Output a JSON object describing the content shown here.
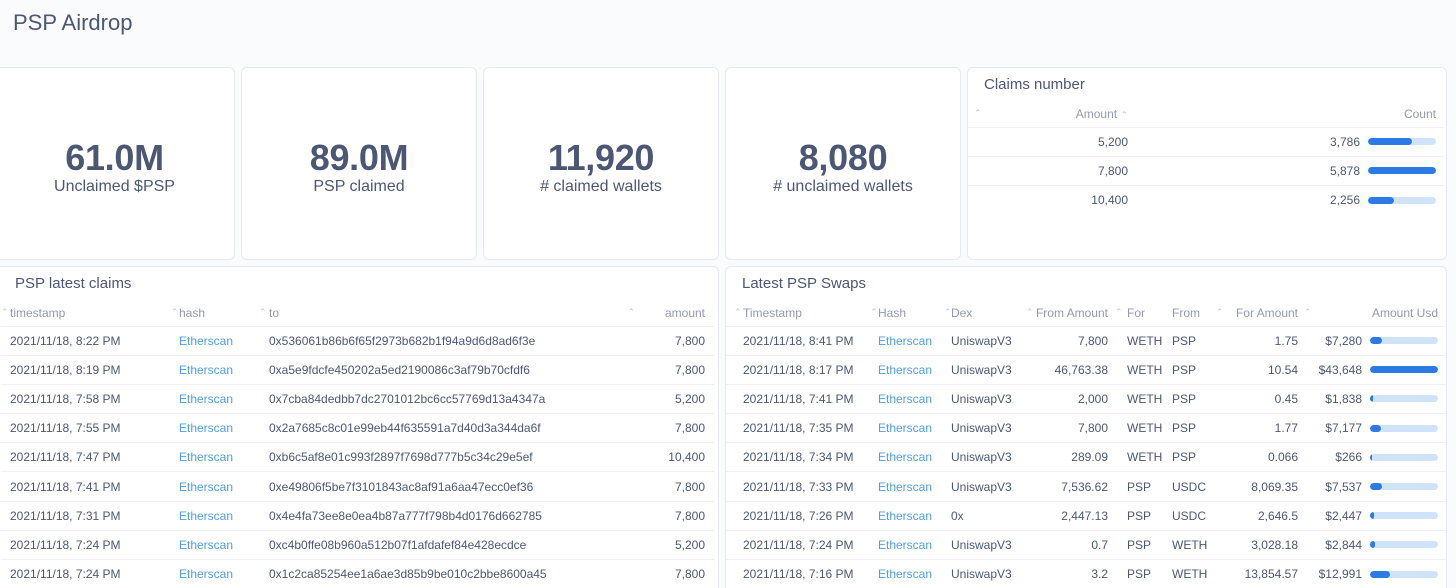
{
  "page": {
    "title": "PSP Airdrop"
  },
  "scalars": [
    {
      "value": "61.0M",
      "label": "Unclaimed $PSP"
    },
    {
      "value": "89.0M",
      "label": "PSP claimed"
    },
    {
      "value": "11,920",
      "label": "# claimed wallets"
    },
    {
      "value": "8,080",
      "label": "# unclaimed wallets"
    }
  ],
  "claims_number": {
    "title": "Claims number",
    "columns": [
      "Amount",
      "Count"
    ],
    "rows": [
      {
        "amount": "5,200",
        "count": "3,786",
        "fraction": 0.644
      },
      {
        "amount": "7,800",
        "count": "5,878",
        "fraction": 1.0
      },
      {
        "amount": "10,400",
        "count": "2,256",
        "fraction": 0.384
      }
    ]
  },
  "latest_claims": {
    "title": "PSP latest claims",
    "columns": [
      "timestamp",
      "hash",
      "to",
      "amount"
    ],
    "rows": [
      {
        "timestamp": "2021/11/18, 8:22 PM",
        "hash": "Etherscan",
        "to": "0x536061b86b6f65f2973b682b1f94a9d6d8ad6f3e",
        "amount": "7,800"
      },
      {
        "timestamp": "2021/11/18, 8:19 PM",
        "hash": "Etherscan",
        "to": "0xa5e9fdcfe450202a5ed2190086c3af79b70cfdf6",
        "amount": "7,800"
      },
      {
        "timestamp": "2021/11/18, 7:58 PM",
        "hash": "Etherscan",
        "to": "0x7cba84dedbb7dc2701012bc6cc57769d13a4347a",
        "amount": "5,200"
      },
      {
        "timestamp": "2021/11/18, 7:55 PM",
        "hash": "Etherscan",
        "to": "0x2a7685c8c01e99eb44f635591a7d40d3a344da6f",
        "amount": "7,800"
      },
      {
        "timestamp": "2021/11/18, 7:47 PM",
        "hash": "Etherscan",
        "to": "0xb6c5af8e01c993f2897f7698d777b5c34c29e5ef",
        "amount": "10,400"
      },
      {
        "timestamp": "2021/11/18, 7:41 PM",
        "hash": "Etherscan",
        "to": "0xe49806f5be7f3101843ac8af91a6aa47ecc0ef36",
        "amount": "7,800"
      },
      {
        "timestamp": "2021/11/18, 7:31 PM",
        "hash": "Etherscan",
        "to": "0x4e4fa73ee8e0ea4b87a777f798b4d0176d662785",
        "amount": "7,800"
      },
      {
        "timestamp": "2021/11/18, 7:24 PM",
        "hash": "Etherscan",
        "to": "0xc4b0ffe08b960a512b07f1afdafef84e428ecdce",
        "amount": "5,200"
      },
      {
        "timestamp": "2021/11/18, 7:24 PM",
        "hash": "Etherscan",
        "to": "0x1c2ca85254ee1a6ae3d85b9be010c2bbe8600a45",
        "amount": "7,800"
      }
    ]
  },
  "latest_swaps": {
    "title": "Latest PSP Swaps",
    "columns": [
      "Timestamp",
      "Hash",
      "Dex",
      "From Amount",
      "For",
      "From",
      "For Amount",
      "Amount Usd"
    ],
    "rows": [
      {
        "timestamp": "2021/11/18, 8:41 PM",
        "hash": "Etherscan",
        "dex": "UniswapV3",
        "from_amount": "7,800",
        "for": "WETH",
        "from": "PSP",
        "for_amount": "1.75",
        "usd": "$7,280",
        "fraction": 0.17
      },
      {
        "timestamp": "2021/11/18, 8:17 PM",
        "hash": "Etherscan",
        "dex": "UniswapV3",
        "from_amount": "46,763.38",
        "for": "WETH",
        "from": "PSP",
        "for_amount": "10.54",
        "usd": "$43,648",
        "fraction": 1.0
      },
      {
        "timestamp": "2021/11/18, 7:41 PM",
        "hash": "Etherscan",
        "dex": "UniswapV3",
        "from_amount": "2,000",
        "for": "WETH",
        "from": "PSP",
        "for_amount": "0.45",
        "usd": "$1,838",
        "fraction": 0.04
      },
      {
        "timestamp": "2021/11/18, 7:35 PM",
        "hash": "Etherscan",
        "dex": "UniswapV3",
        "from_amount": "7,800",
        "for": "WETH",
        "from": "PSP",
        "for_amount": "1.77",
        "usd": "$7,177",
        "fraction": 0.16
      },
      {
        "timestamp": "2021/11/18, 7:34 PM",
        "hash": "Etherscan",
        "dex": "UniswapV3",
        "from_amount": "289.09",
        "for": "WETH",
        "from": "PSP",
        "for_amount": "0.066",
        "usd": "$266",
        "fraction": 0.01
      },
      {
        "timestamp": "2021/11/18, 7:33 PM",
        "hash": "Etherscan",
        "dex": "UniswapV3",
        "from_amount": "7,536.62",
        "for": "PSP",
        "from": "USDC",
        "for_amount": "8,069.35",
        "usd": "$7,537",
        "fraction": 0.17
      },
      {
        "timestamp": "2021/11/18, 7:26 PM",
        "hash": "Etherscan",
        "dex": "0x",
        "from_amount": "2,447.13",
        "for": "PSP",
        "from": "USDC",
        "for_amount": "2,646.5",
        "usd": "$2,447",
        "fraction": 0.06
      },
      {
        "timestamp": "2021/11/18, 7:24 PM",
        "hash": "Etherscan",
        "dex": "UniswapV3",
        "from_amount": "0.7",
        "for": "PSP",
        "from": "WETH",
        "for_amount": "3,028.18",
        "usd": "$2,844",
        "fraction": 0.07
      },
      {
        "timestamp": "2021/11/18, 7:16 PM",
        "hash": "Etherscan",
        "dex": "UniswapV3",
        "from_amount": "3.2",
        "for": "PSP",
        "from": "WETH",
        "for_amount": "13,854.57",
        "usd": "$12,991",
        "fraction": 0.3
      }
    ]
  },
  "colors": {
    "bar_fill": "#2c7be5",
    "bar_track": "#cfe4fb",
    "link": "#509ee3",
    "text": "#4c5773"
  },
  "icons": {
    "sort": "sort-arrow-icon"
  }
}
